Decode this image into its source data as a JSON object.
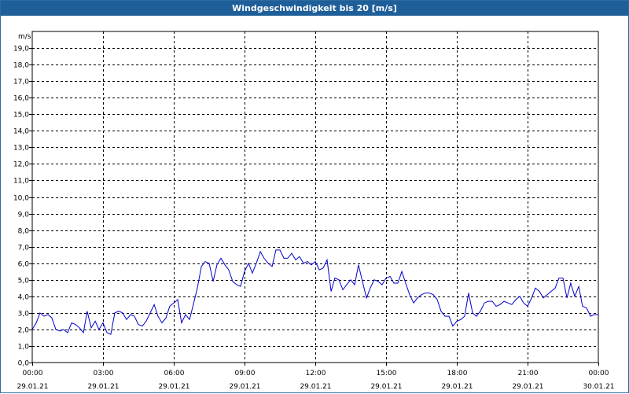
{
  "window": {
    "title": "Windgeschwindigkeit bis 20 [m/s]"
  },
  "chart_data": {
    "type": "line",
    "title": "Windgeschwindigkeit bis 20 [m/s]",
    "ylabel": "m/s",
    "ylim": [
      0,
      20
    ],
    "yticks": [
      "0,0",
      "1,0",
      "2,0",
      "3,0",
      "4,0",
      "5,0",
      "6,0",
      "7,0",
      "8,0",
      "9,0",
      "10,0",
      "11,0",
      "12,0",
      "13,0",
      "14,0",
      "15,0",
      "16,0",
      "17,0",
      "18,0",
      "19,0"
    ],
    "xlim_hours": [
      0,
      24
    ],
    "xticks": [
      {
        "time": "00:00",
        "date": "29.01.21"
      },
      {
        "time": "03:00",
        "date": "29.01.21"
      },
      {
        "time": "06:00",
        "date": "29.01.21"
      },
      {
        "time": "09:00",
        "date": "29.01.21"
      },
      {
        "time": "12:00",
        "date": "29.01.21"
      },
      {
        "time": "15:00",
        "date": "29.01.21"
      },
      {
        "time": "18:00",
        "date": "29.01.21"
      },
      {
        "time": "21:00",
        "date": "29.01.21"
      },
      {
        "time": "00:00",
        "date": "30.01.21"
      }
    ],
    "grid": true,
    "line_color": "#0000cc",
    "series": [
      {
        "x_hours": [
          0,
          0.17,
          0.33,
          0.5,
          0.67,
          0.83,
          1,
          1.17,
          1.33,
          1.5,
          1.67,
          1.83,
          2,
          2.17,
          2.33,
          2.5,
          2.67,
          2.83,
          3,
          3.17,
          3.33,
          3.5,
          3.67,
          3.83,
          4,
          4.17,
          4.33,
          4.5,
          4.67,
          4.83,
          5,
          5.17,
          5.33,
          5.5,
          5.67,
          5.83,
          6,
          6.17,
          6.33,
          6.5,
          6.67,
          6.83,
          7,
          7.17,
          7.33,
          7.5,
          7.67,
          7.83,
          8,
          8.17,
          8.33,
          8.5,
          8.67,
          8.83,
          9,
          9.17,
          9.33,
          9.5,
          9.67,
          9.83,
          10,
          10.17,
          10.33,
          10.5,
          10.67,
          10.83,
          11,
          11.17,
          11.33,
          11.5,
          11.67,
          11.83,
          12,
          12.17,
          12.33,
          12.5,
          12.67,
          12.83,
          13,
          13.17,
          13.33,
          13.5,
          13.67,
          13.83,
          14,
          14.17,
          14.33,
          14.5,
          14.67,
          14.83,
          15,
          15.17,
          15.33,
          15.5,
          15.67,
          15.83,
          16,
          16.17,
          16.33,
          16.5,
          16.67,
          16.83,
          17,
          17.17,
          17.33,
          17.5,
          17.67,
          17.83,
          18,
          18.17,
          18.33,
          18.5,
          18.67,
          18.83,
          19,
          19.17,
          19.33,
          19.5,
          19.67,
          19.83,
          20,
          20.17,
          20.33,
          20.5,
          20.67,
          20.83,
          21,
          21.17,
          21.33,
          21.5,
          21.67,
          21.83,
          22,
          22.17,
          22.33,
          22.5,
          22.67,
          22.83,
          23,
          23.17,
          23.33,
          23.5,
          23.67,
          23.83,
          24
        ],
        "values": [
          2.0,
          2.4,
          3.0,
          2.8,
          2.9,
          2.7,
          2.0,
          1.9,
          2.0,
          1.8,
          2.4,
          2.3,
          2.1,
          1.8,
          3.1,
          2.1,
          2.5,
          2.0,
          2.4,
          1.8,
          1.7,
          3.0,
          3.1,
          3.0,
          2.6,
          2.9,
          2.8,
          2.3,
          2.2,
          2.5,
          3.0,
          3.5,
          2.8,
          2.4,
          2.7,
          3.4,
          3.6,
          3.8,
          2.4,
          2.9,
          2.6,
          3.5,
          4.5,
          5.8,
          6.1,
          6.0,
          4.9,
          5.9,
          6.3,
          5.9,
          5.6,
          4.9,
          4.7,
          4.6,
          5.5,
          6.0,
          5.4,
          6.0,
          6.7,
          6.3,
          6.0,
          5.8,
          6.8,
          6.8,
          6.3,
          6.3,
          6.6,
          6.2,
          6.4,
          6.0,
          6.1,
          5.9,
          6.1,
          5.6,
          5.7,
          6.2,
          4.3,
          5.1,
          5.0,
          4.4,
          4.7,
          5.0,
          4.7,
          5.9,
          4.9,
          3.9,
          4.5,
          5.0,
          4.9,
          4.7,
          5.1,
          5.2,
          4.8,
          4.8,
          5.5,
          4.8,
          4.1,
          3.6,
          3.9,
          4.1,
          4.2,
          4.2,
          4.1,
          3.8,
          3.1,
          2.8,
          2.8,
          2.2,
          2.5,
          2.6,
          2.8,
          4.2,
          3.0,
          2.8,
          3.1,
          3.6,
          3.7,
          3.7,
          3.4,
          3.5,
          3.7,
          3.6,
          3.5,
          3.8,
          4.0,
          3.6,
          3.4,
          3.9,
          4.5,
          4.3,
          3.9,
          4.1,
          4.3,
          4.5,
          5.1,
          5.1,
          3.9,
          4.8,
          4.0,
          4.6,
          3.4,
          3.3,
          2.8,
          2.9,
          2.9,
          3.6
        ]
      }
    ]
  }
}
